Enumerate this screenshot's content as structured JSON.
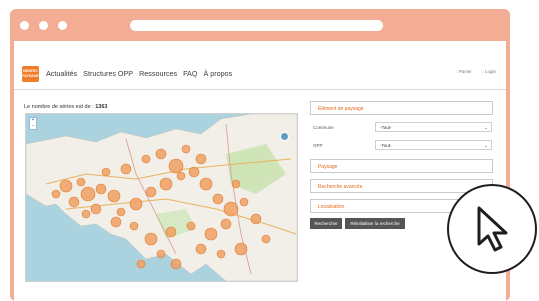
{
  "browser": {
    "dots": 3
  },
  "nav": {
    "logo_text": "OBSERV. PAYSAGE",
    "links": [
      "Actualités",
      "Structures OPP",
      "Ressources",
      "FAQ",
      "À propos"
    ],
    "panier": "Panier",
    "login": "Login"
  },
  "page": {
    "count_label": "Le nombre de séries est de :",
    "count_value": "1363"
  },
  "map": {
    "zoom_in": "+",
    "zoom_out": "−"
  },
  "panel": {
    "element_paysage": "Élément de paysage",
    "commune_label": "Commune",
    "commune_value": "-Tout-",
    "opp_label": "OPP",
    "opp_value": "-Tout-",
    "paysage": "Paysage",
    "recherche_avancee": "Recherche avancée",
    "localisation": "Localisation",
    "search_button": "Rechercher",
    "reset_button": "Réinitialiser la recherche"
  },
  "colors": {
    "frame": "#f3ad94",
    "accent": "#e26a1b",
    "cluster": "#f0a062",
    "sea": "#aad3df",
    "land": "#f2efe9"
  },
  "icons": {
    "pointer": "mouse-pointer-icon",
    "panier": "basket-icon",
    "login": "user-icon"
  }
}
